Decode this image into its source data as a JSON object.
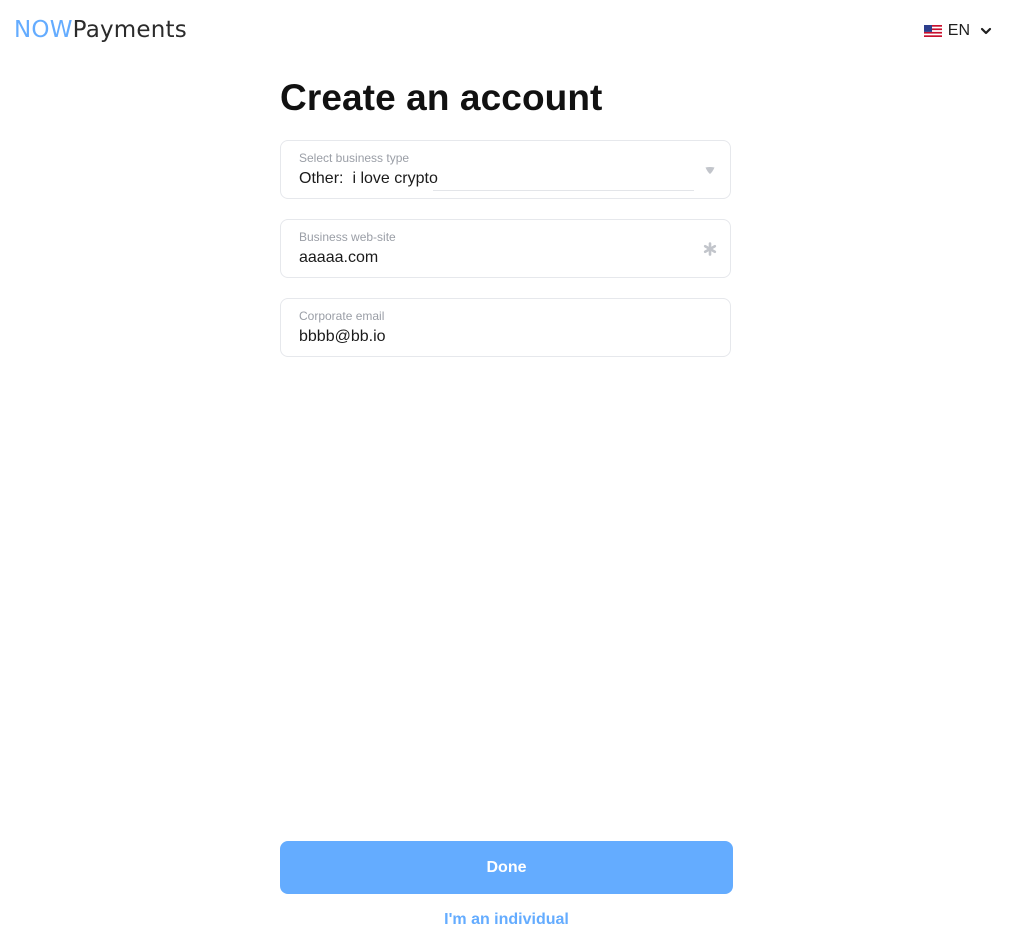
{
  "header": {
    "logo_now": "NOW",
    "logo_payments": "Payments",
    "language": {
      "code": "EN",
      "flag_icon": "us-flag-icon",
      "chevron_icon": "chevron-down-icon"
    }
  },
  "form": {
    "title": "Create an account",
    "business_type": {
      "label": "Select business type",
      "selected": "Other:",
      "other_value": "i love crypto",
      "icon": "dropdown-arrow-icon"
    },
    "website": {
      "label": "Business web-site",
      "value": "aaaaa.com",
      "icon": "required-asterisk-icon"
    },
    "email": {
      "label": "Corporate email",
      "value": "bbbb@bb.io"
    },
    "done_label": "Done",
    "individual_link": "I'm an individual"
  },
  "colors": {
    "accent": "#64acff",
    "text": "#1b1b1b",
    "muted": "#9a9ea6",
    "border": "#e6e8ec"
  }
}
